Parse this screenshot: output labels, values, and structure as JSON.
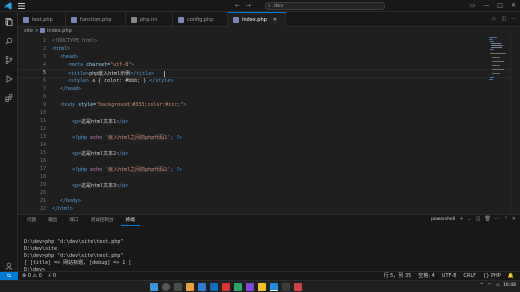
{
  "titlebar": {
    "search_text": "dev",
    "nav_arrows": "← →"
  },
  "tabs": [
    {
      "label": "test.php",
      "active": false
    },
    {
      "label": "function.php",
      "active": false
    },
    {
      "label": "php.ini",
      "active": false
    },
    {
      "label": "config.php",
      "active": false
    },
    {
      "label": "index.php",
      "active": true
    }
  ],
  "breadcrumb": {
    "folder": "site",
    "sep": ">",
    "file": "index.php"
  },
  "editor": {
    "lines": [
      {
        "n": "1"
      },
      {
        "n": "2"
      },
      {
        "n": "3"
      },
      {
        "n": "4"
      },
      {
        "n": "5"
      },
      {
        "n": "6"
      },
      {
        "n": "7"
      },
      {
        "n": "8"
      },
      {
        "n": "9"
      },
      {
        "n": "10"
      },
      {
        "n": "11"
      },
      {
        "n": "12"
      },
      {
        "n": "13"
      },
      {
        "n": "14"
      },
      {
        "n": "15"
      },
      {
        "n": "16"
      },
      {
        "n": "17"
      },
      {
        "n": "18"
      },
      {
        "n": "19"
      },
      {
        "n": "20"
      },
      {
        "n": "21"
      },
      {
        "n": "22"
      }
    ],
    "code": {
      "l1": "<!DOCTYPE html>",
      "l2": "<html>",
      "l3": "<head>",
      "l4a": "<meta ",
      "l4b": "charset",
      "l4c": "=",
      "l4d": "\"utf-8\"",
      "l4e": ">",
      "l5a": "<title>",
      "l5b": "php嵌入html示例",
      "l5c": "</title>",
      "l6a": "<style>",
      "l6b": " a { color: #bbb; } ",
      "l6c": "</style>",
      "l7": "</head>",
      "l9a": "<body ",
      "l9b": "style",
      "l9c": "=",
      "l9d": "\"background:#333;color:#ccc;\"",
      "l9e": ">",
      "l11a": "<p>",
      "l11b": "这是html文本1",
      "l11c": "</p>",
      "l13a": "<?php",
      "l13b": " echo ",
      "l13c": "'嵌入html之间的php代码1'",
      "l13d": "; ?>",
      "l15a": "<p>",
      "l15b": "这是html文本2",
      "l15c": "</p>",
      "l17a": "<?php",
      "l17b": " echo ",
      "l17c": "'嵌入html之间的php代码2'",
      "l17d": "; ?>",
      "l19a": "<p>",
      "l19b": "这是html文本3",
      "l19c": "</p>",
      "l21": "</body>",
      "l22": "</html>"
    }
  },
  "panel": {
    "tabs": [
      "问题",
      "输出",
      "端口",
      "调试控制台",
      "终端"
    ],
    "active_tab": "终端",
    "shell_label": "powershell",
    "terminal_lines": [
      "D:\\dev>php \"d:\\dev\\site\\test.php\"",
      "D:\\dev\\site",
      "D:\\dev>php \"d:\\dev\\site\\test.php\"",
      "[ [title] => 网站标题, [debug] => 1 ]",
      "D:\\dev>"
    ]
  },
  "statusbar": {
    "left": [
      "⊗ 0 ⚠ 0",
      "⚡ 0"
    ],
    "position": "行 5，列 35",
    "spaces": "空格: 4",
    "encoding": "UTF-8",
    "eol": "CRLF",
    "language": "{} PHP"
  },
  "taskbar": {
    "time": "16:48"
  },
  "colors": {
    "accent": "#0078d4",
    "bg": "#1f1f1f",
    "tag": "#569cd6",
    "attr": "#9cdcfe",
    "string": "#ce9178"
  }
}
